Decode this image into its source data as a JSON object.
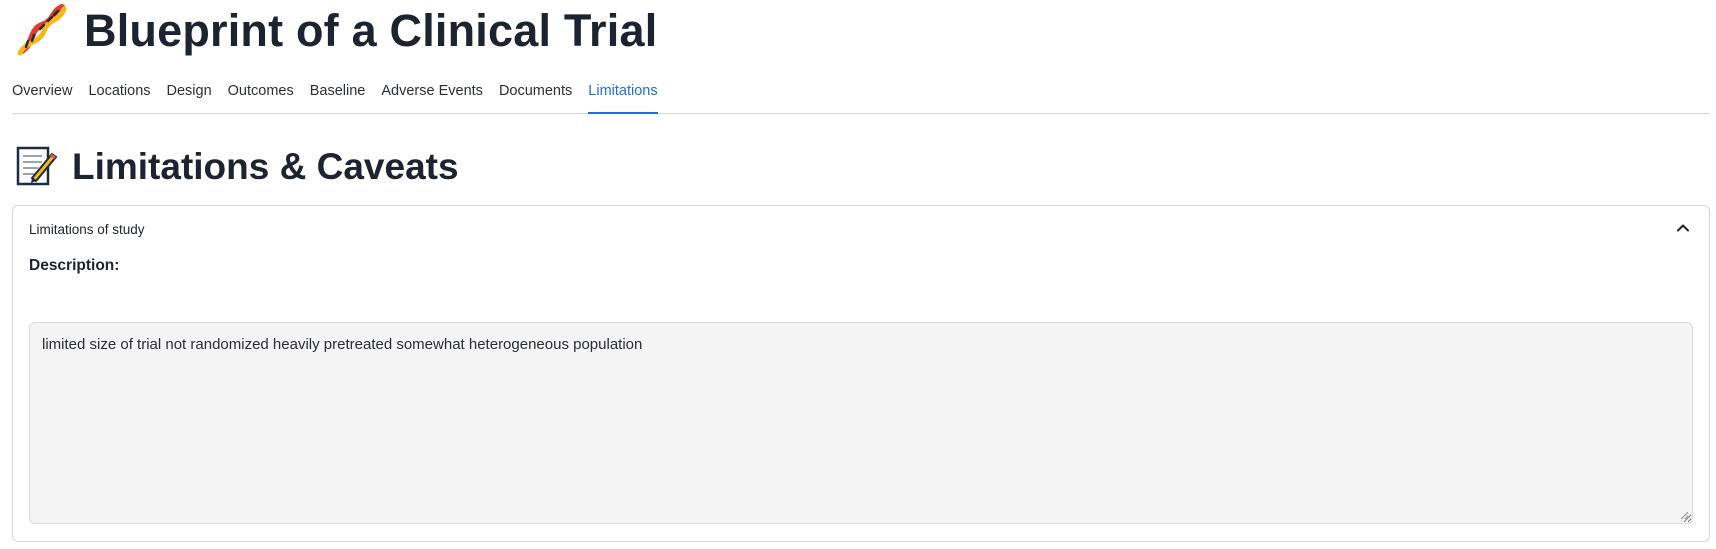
{
  "header": {
    "title": "Blueprint of a Clinical Trial",
    "icon": "dna-icon"
  },
  "tabs": [
    {
      "label": "Overview",
      "active": false
    },
    {
      "label": "Locations",
      "active": false
    },
    {
      "label": "Design",
      "active": false
    },
    {
      "label": "Outcomes",
      "active": false
    },
    {
      "label": "Baseline",
      "active": false
    },
    {
      "label": "Adverse Events",
      "active": false
    },
    {
      "label": "Documents",
      "active": false
    },
    {
      "label": "Limitations",
      "active": true
    }
  ],
  "section": {
    "title": "Limitations & Caveats",
    "icon": "memo-icon"
  },
  "expander": {
    "label": "Limitations of study",
    "expanded": true,
    "description_label": "Description:",
    "description_value": "limited size of trial not randomized heavily pretreated somewhat heterogeneous population"
  },
  "colors": {
    "accent": "#1f6fd1",
    "text": "#1e2330",
    "border": "#d6d8dc",
    "textarea_bg": "#f4f4f5"
  }
}
